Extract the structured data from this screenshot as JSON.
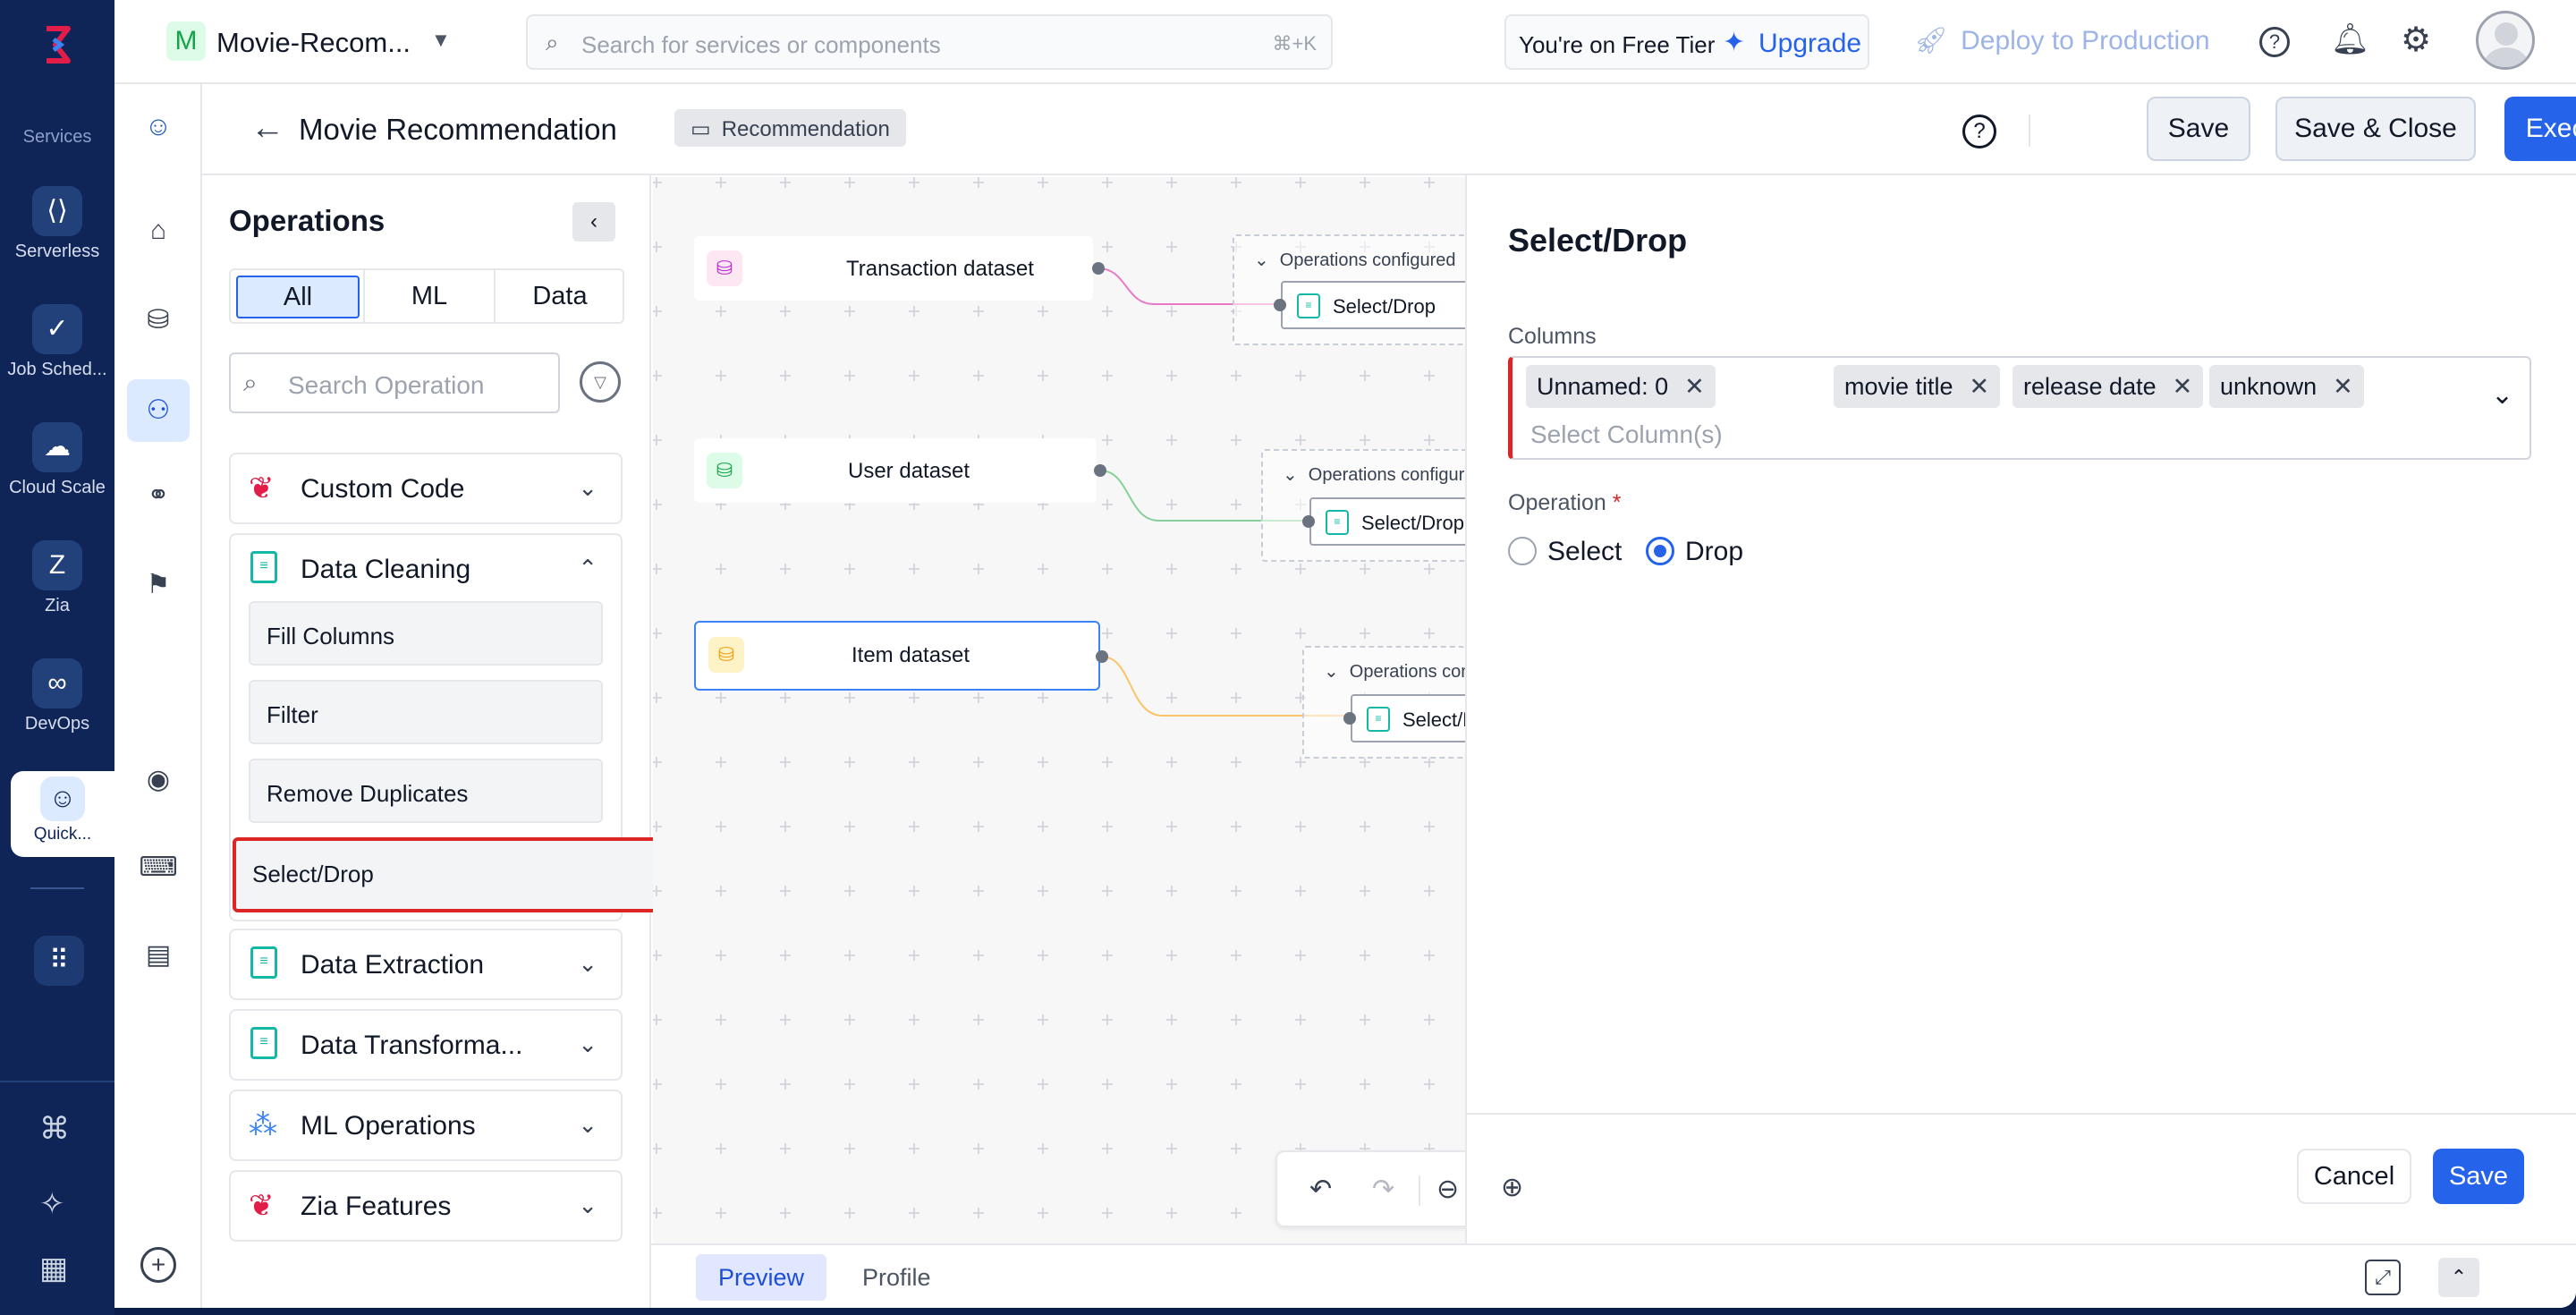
{
  "rail": {
    "section_label": "Services",
    "items": [
      {
        "label": "Serverless",
        "icon": "serverless-icon"
      },
      {
        "label": "Job Sched...",
        "icon": "job-scheduler-icon"
      },
      {
        "label": "Cloud Scale",
        "icon": "cloud-scale-icon"
      },
      {
        "label": "Zia",
        "icon": "zia-icon"
      },
      {
        "label": "DevOps",
        "icon": "devops-icon"
      },
      {
        "label": "Quick...",
        "icon": "quickml-icon"
      }
    ]
  },
  "topbar": {
    "project_initial": "M",
    "project_name": "Movie-Recom...",
    "search_placeholder": "Search for services or components",
    "search_shortcut": "⌘+K",
    "tier_text": "You're on Free Tier",
    "upgrade_label": "Upgrade",
    "deploy_label": "Deploy to Production"
  },
  "header": {
    "title": "Movie Recommendation",
    "tag": "Recommendation",
    "save_label": "Save",
    "save_close_label": "Save & Close",
    "execute_label": "Execute"
  },
  "operations": {
    "title": "Operations",
    "tabs": [
      "All",
      "ML",
      "Data"
    ],
    "active_tab": "All",
    "search_placeholder": "Search Operation",
    "groups": [
      {
        "label": "Custom Code",
        "icon": "brain-icon",
        "expanded": false
      },
      {
        "label": "Data Cleaning",
        "icon": "document-icon",
        "expanded": true,
        "items": [
          "Fill Columns",
          "Filter",
          "Remove Duplicates",
          "Select/Drop"
        ]
      },
      {
        "label": "Data Extraction",
        "icon": "document-icon",
        "expanded": false
      },
      {
        "label": "Data Transforma...",
        "icon": "document-icon",
        "expanded": false
      },
      {
        "label": "ML Operations",
        "icon": "nodes-icon",
        "expanded": false
      },
      {
        "label": "Zia Features",
        "icon": "brain-icon",
        "expanded": false
      }
    ]
  },
  "canvas": {
    "datasets": [
      {
        "label": "Transaction dataset",
        "color": "#c026d3",
        "line_color": "#d946ef"
      },
      {
        "label": "User dataset",
        "color": "#16a34a",
        "line_color": "#4ade80"
      },
      {
        "label": "Item dataset",
        "color": "#f59e0b",
        "line_color": "#fbbf24"
      }
    ],
    "ops_header": "Operations configured",
    "op_label": "Select/Drop"
  },
  "bottom_tabs": {
    "preview": "Preview",
    "profile": "Profile"
  },
  "config": {
    "title": "Select/Drop",
    "columns_label": "Columns",
    "selected_columns": [
      "Unnamed: 0",
      "movie title",
      "release date",
      "unknown"
    ],
    "columns_placeholder": "Select Column(s)",
    "operation_label": "Operation",
    "required_mark": "*",
    "options": [
      "Select",
      "Drop"
    ],
    "selected_option": "Drop",
    "cancel_label": "Cancel",
    "save_label": "Save"
  },
  "colors": {
    "accent": "#2563eb",
    "rail": "#0f2557",
    "highlight": "#dc2626"
  }
}
